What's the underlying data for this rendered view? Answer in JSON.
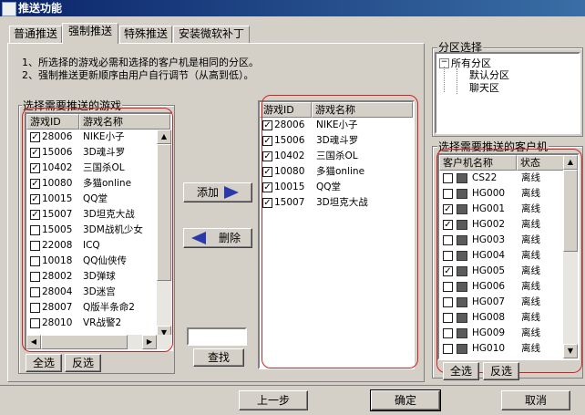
{
  "window": {
    "title": "推送功能"
  },
  "tabs": [
    {
      "label": "普通推送",
      "active": false
    },
    {
      "label": "强制推送",
      "active": true
    },
    {
      "label": "特殊推送",
      "active": false
    },
    {
      "label": "安装微软补丁",
      "active": false
    }
  ],
  "notes": [
    "1、所选择的游戏必需和选择的客户机是相同的分区。",
    "2、强制推送更新顺序由用户自行调节（从高到低）。"
  ],
  "source_games": {
    "title": "选择需要推送的游戏",
    "columns": [
      "游戏ID",
      "游戏名称"
    ],
    "rows": [
      {
        "id": "28006",
        "name": "NIKE小子",
        "checked": true
      },
      {
        "id": "15006",
        "name": "3D魂斗罗",
        "checked": true
      },
      {
        "id": "10402",
        "name": "三国杀OL",
        "checked": true
      },
      {
        "id": "10080",
        "name": "多猫online",
        "checked": true
      },
      {
        "id": "10015",
        "name": "QQ堂",
        "checked": true
      },
      {
        "id": "15007",
        "name": "3D坦克大战",
        "checked": true
      },
      {
        "id": "15005",
        "name": "3DM战机少女",
        "checked": false
      },
      {
        "id": "22008",
        "name": "ICQ",
        "checked": false
      },
      {
        "id": "10018",
        "name": "QQ仙侠传",
        "checked": false
      },
      {
        "id": "28002",
        "name": "3D弹球",
        "checked": false
      },
      {
        "id": "28004",
        "name": "3D迷宫",
        "checked": false
      },
      {
        "id": "28007",
        "name": "Q版半条命2",
        "checked": false
      },
      {
        "id": "28010",
        "name": "VR战警2",
        "checked": false
      }
    ],
    "select_all": "全选",
    "invert": "反选"
  },
  "actions": {
    "add": "添加",
    "delete": "删除",
    "search": "查找",
    "search_value": ""
  },
  "selected_games": {
    "columns": [
      "游戏ID",
      "游戏名称"
    ],
    "rows": [
      {
        "id": "28006",
        "name": "NIKE小子",
        "checked": true
      },
      {
        "id": "15006",
        "name": "3D魂斗罗",
        "checked": true
      },
      {
        "id": "10402",
        "name": "三国杀OL",
        "checked": true
      },
      {
        "id": "10080",
        "name": "多猫online",
        "checked": true
      },
      {
        "id": "10015",
        "name": "QQ堂",
        "checked": true
      },
      {
        "id": "15007",
        "name": "3D坦克大战",
        "checked": true
      }
    ]
  },
  "partition": {
    "title": "分区选择",
    "root": "所有分区",
    "children": [
      "默认分区",
      "聊天区"
    ]
  },
  "clients": {
    "title": "选择需要推送的客户机",
    "columns": [
      "客户机名称",
      "状态"
    ],
    "rows": [
      {
        "name": "CS22",
        "status": "离线",
        "checked": false
      },
      {
        "name": "HG000",
        "status": "离线",
        "checked": false
      },
      {
        "name": "HG001",
        "status": "离线",
        "checked": true
      },
      {
        "name": "HG002",
        "status": "离线",
        "checked": true
      },
      {
        "name": "HG003",
        "status": "离线",
        "checked": false
      },
      {
        "name": "HG004",
        "status": "离线",
        "checked": false
      },
      {
        "name": "HG005",
        "status": "离线",
        "checked": true
      },
      {
        "name": "HG006",
        "status": "离线",
        "checked": false
      },
      {
        "name": "HG007",
        "status": "离线",
        "checked": false
      },
      {
        "name": "HG008",
        "status": "离线",
        "checked": false
      },
      {
        "name": "HG009",
        "status": "离线",
        "checked": false
      },
      {
        "name": "HG010",
        "status": "离线",
        "checked": false
      }
    ],
    "select_all": "全选",
    "invert": "反选"
  },
  "footer": {
    "prev": "上一步",
    "ok": "确定",
    "cancel": "取消"
  },
  "colors": {
    "title_bar": "#0a246a",
    "annotation": "#d62020",
    "arrow": "#2a3aa8"
  }
}
